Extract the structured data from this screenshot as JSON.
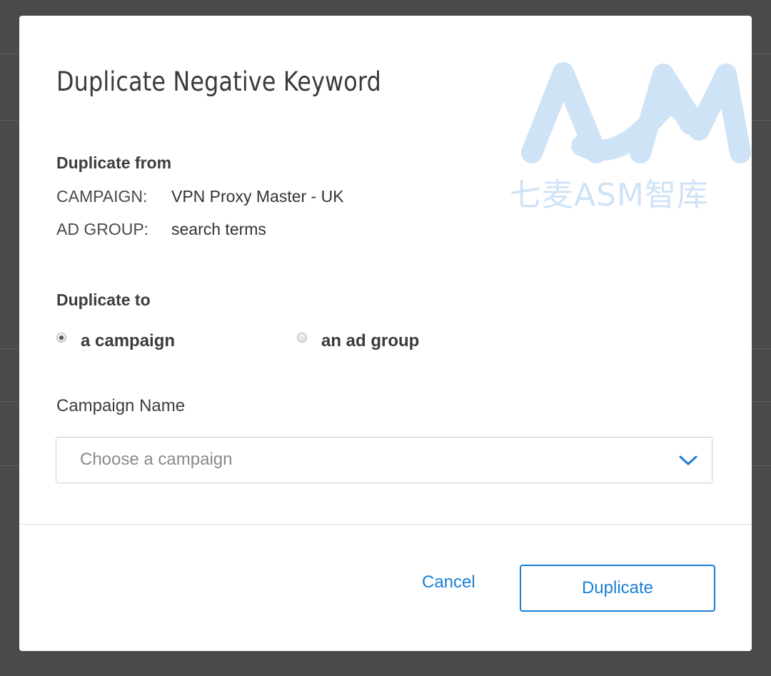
{
  "dialog": {
    "title": "Duplicate Negative Keyword",
    "from": {
      "heading": "Duplicate from",
      "campaign_key": "CAMPAIGN:",
      "campaign_value": "VPN Proxy Master - UK",
      "adgroup_key": "AD GROUP:",
      "adgroup_value": "search terms"
    },
    "to": {
      "heading": "Duplicate to",
      "options": [
        {
          "label": "a campaign",
          "selected": true
        },
        {
          "label": "an ad group",
          "selected": false
        }
      ]
    },
    "campaign_field": {
      "label": "Campaign Name",
      "placeholder": "Choose a campaign"
    },
    "buttons": {
      "cancel": "Cancel",
      "duplicate": "Duplicate"
    }
  },
  "watermark": {
    "text": "七麦ASM智库",
    "color": "#cfe3f7"
  },
  "colors": {
    "accent": "#1a7fd4",
    "backdrop": "#4a4a4a"
  },
  "icons": [
    "chevron-down-icon",
    "radio-icon"
  ]
}
